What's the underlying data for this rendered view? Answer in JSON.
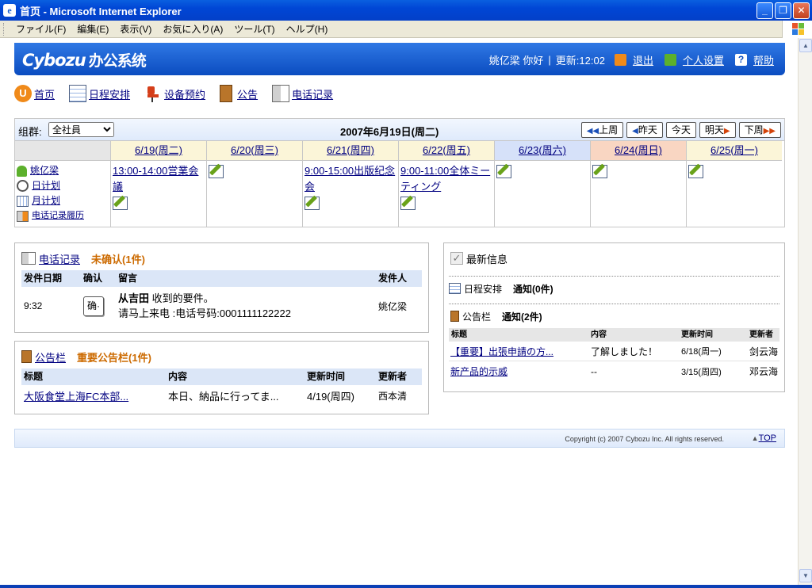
{
  "window": {
    "title": "首页 - Microsoft Internet Explorer"
  },
  "menu": [
    "ファイル(F)",
    "編集(E)",
    "表示(V)",
    "お気に入り(A)",
    "ツール(T)",
    "ヘルプ(H)"
  ],
  "header": {
    "logo": "Cybozu",
    "system": "办公系统",
    "greeting": "姚亿梁 你好",
    "update_time": "更新:12:02",
    "logout": "退出",
    "personal": "个人设置",
    "help": "帮助"
  },
  "nav": [
    "首页",
    "日程安排",
    "设备预约",
    "公告",
    "电话记录"
  ],
  "calendar": {
    "group_label": "组群:",
    "group_value": "全社員",
    "date": "2007年6月19日(周二)",
    "buttons": [
      "上周",
      "昨天",
      "今天",
      "明天",
      "下周"
    ],
    "days": [
      "6/19(周二)",
      "6/20(周三)",
      "6/21(周四)",
      "6/22(周五)",
      "6/23(周六)",
      "6/24(周日)",
      "6/25(周一)"
    ],
    "events": [
      "13:00-14:00営業会議",
      "",
      "9:00-15:00出版纪念会",
      "9:00-11:00全体ミーティング",
      "",
      "",
      ""
    ],
    "user_links": [
      "姚亿梁",
      "日计划",
      "月计划",
      "电话记录履历"
    ]
  },
  "phone": {
    "title": "电话记录",
    "count": "未确认(1件)",
    "headers": [
      "发件日期",
      "确认",
      "留言",
      "发件人"
    ],
    "row": {
      "time": "9:32",
      "confirm": "确·",
      "from_name": "从吉田",
      "msg1": "收到的要件。",
      "msg2": "请马上来电 :电话号码:0001111122222",
      "sender": "姚亿梁"
    }
  },
  "notice": {
    "title": "公告栏",
    "count": "重要公告栏(1件)",
    "headers": [
      "标题",
      "内容",
      "更新时间",
      "更新者"
    ],
    "row": {
      "title": "大阪食堂上海FC本部...",
      "content": "本日、納品に行ってま...",
      "time": "4/19(周四)",
      "author": "西本清"
    }
  },
  "latest": {
    "title": "最新信息",
    "schedule_label": "日程安排",
    "schedule_notice": "通知(0件)",
    "notice_label": "公告栏",
    "notice_notice": "通知(2件)",
    "headers": [
      "标题",
      "内容",
      "更新时间",
      "更新者"
    ],
    "rows": [
      {
        "title": "【重要】出張申請の方...",
        "content": "了解しました！",
        "time": "6/18(周一)",
        "author": "剑云海"
      },
      {
        "title": "新产品的示威",
        "content": "--",
        "time": "3/15(周四)",
        "author": "邓云海"
      }
    ]
  },
  "footer": {
    "copyright": "Copyright (c) 2007 Cybozu Inc. All rights reserved.",
    "top": "TOP"
  }
}
